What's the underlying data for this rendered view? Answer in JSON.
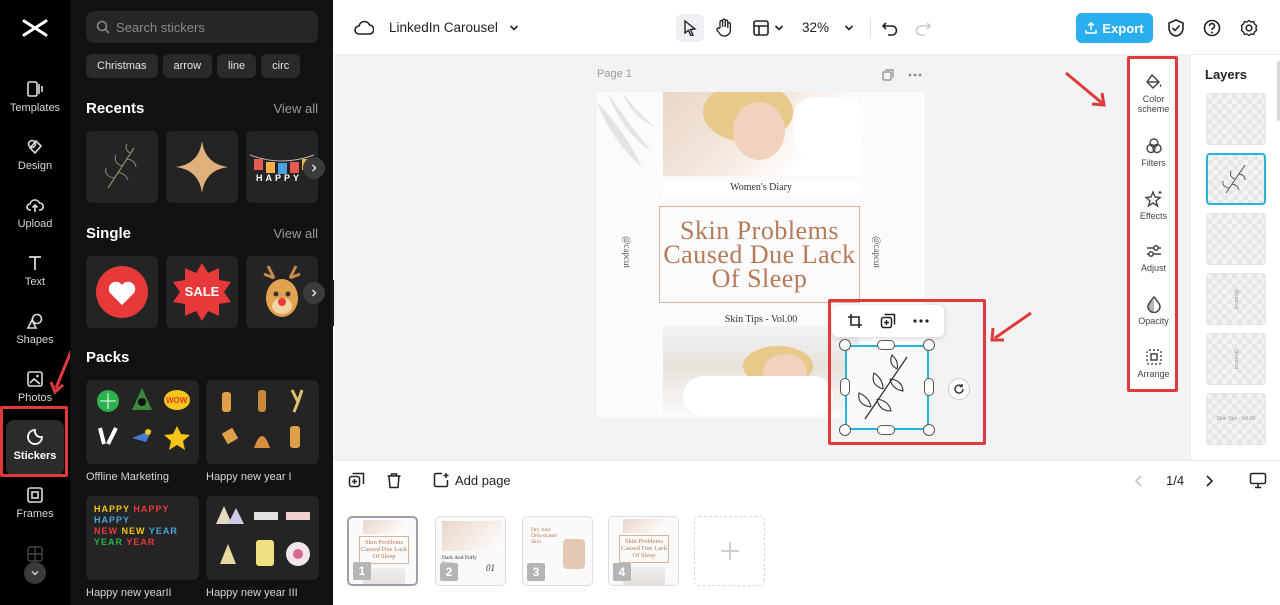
{
  "rail": {
    "items": [
      {
        "label": "Templates"
      },
      {
        "label": "Design"
      },
      {
        "label": "Upload"
      },
      {
        "label": "Text"
      },
      {
        "label": "Shapes"
      },
      {
        "label": "Photos"
      },
      {
        "label": "Stickers"
      },
      {
        "label": "Frames"
      }
    ]
  },
  "panel": {
    "search_placeholder": "Search stickers",
    "chips": [
      "Christmas",
      "arrow",
      "line",
      "circ"
    ],
    "recents_title": "Recents",
    "recents_view_all": "View all",
    "single_title": "Single",
    "single_view_all": "View all",
    "sale_text": "SALE",
    "happy_tile": "HAPPY",
    "packs_title": "Packs",
    "packs": [
      {
        "label": "Offline Marketing"
      },
      {
        "label": "Happy new year I"
      },
      {
        "label": "Happy new yearII"
      },
      {
        "label": "Happy new year III"
      }
    ],
    "pack_text": {
      "wow": "WOW",
      "happy": "HAPPY",
      "new": "NEW",
      "year": "YEAR"
    }
  },
  "topbar": {
    "doc_title": "LinkedIn Carousel",
    "zoom": "32%",
    "export_label": "Export"
  },
  "canvas": {
    "page_label": "Page 1",
    "diary": "Women's Diary",
    "title": "Skin Problems Caused Due Lack Of Sleep",
    "tips": "Skin Tips - Vol.00",
    "left_vertical": "@capcut",
    "right_vertical": "@capcut"
  },
  "tools": [
    {
      "label": "Color scheme"
    },
    {
      "label": "Filters"
    },
    {
      "label": "Effects"
    },
    {
      "label": "Adjust"
    },
    {
      "label": "Opacity"
    },
    {
      "label": "Arrange"
    }
  ],
  "layers": {
    "title": "Layers",
    "thumb_texts": [
      "@capcut",
      "@capcut",
      "Skin Tips - Vol.00"
    ]
  },
  "bottombar": {
    "add_page": "Add page",
    "pager": "1/4"
  },
  "thumbs": [
    {
      "num": "1",
      "text": "Skin Problems Caused Due Lack Of Sleep"
    },
    {
      "num": "2",
      "text": "Dark And Puffy Eyes",
      "extra": "01"
    },
    {
      "num": "3",
      "text": "Dry And Dehydrated Skin"
    },
    {
      "num": "4",
      "text": "Skin Problems Caused Due Lack Of Sleep"
    }
  ],
  "colors": {
    "accent": "#29aef0",
    "selection": "#22b7d6",
    "annotation": "#e03a3a",
    "title_brown": "#b57a57"
  }
}
